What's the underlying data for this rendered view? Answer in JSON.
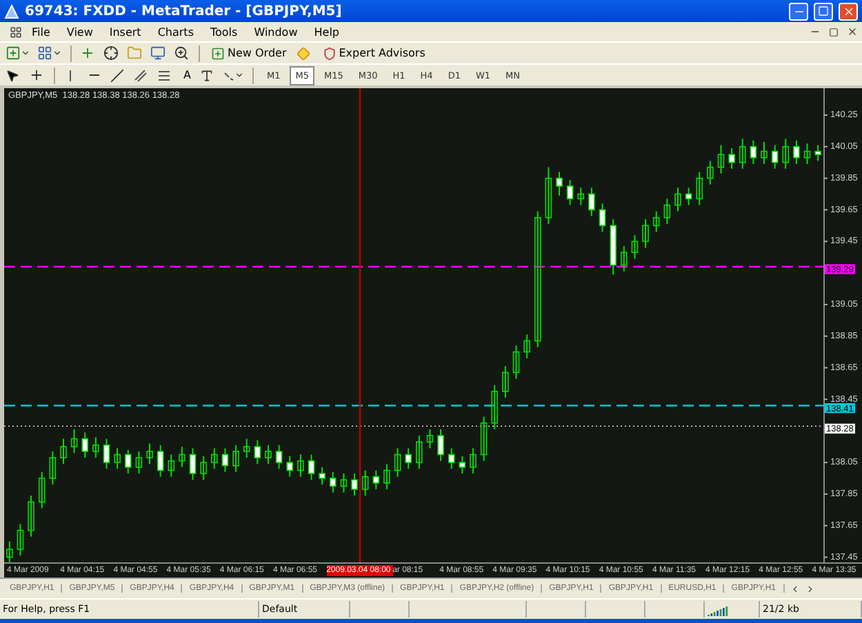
{
  "window": {
    "title": "69743: FXDD - MetaTrader - [GBPJPY,M5]"
  },
  "menu": [
    "File",
    "View",
    "Insert",
    "Charts",
    "Tools",
    "Window",
    "Help"
  ],
  "toolbar": {
    "new_order": "New Order",
    "expert_advisors": "Expert Advisors"
  },
  "drawing_tools": {
    "text_tool": "A"
  },
  "periods": [
    {
      "label": "M1",
      "selected": false
    },
    {
      "label": "M5",
      "selected": true
    },
    {
      "label": "M15",
      "selected": false
    },
    {
      "label": "M30",
      "selected": false
    },
    {
      "label": "H1",
      "selected": false
    },
    {
      "label": "H4",
      "selected": false
    },
    {
      "label": "D1",
      "selected": false
    },
    {
      "label": "W1",
      "selected": false
    },
    {
      "label": "MN",
      "selected": false
    }
  ],
  "chart": {
    "info": "GBPJPY,M5  138.28 138.38 138.26 138.28",
    "chart_data": {
      "type": "candlestick",
      "ylim": [
        137.4,
        140.42
      ],
      "ref_lines": [
        {
          "axis": "y",
          "value": 139.29,
          "label": "139.29",
          "color": "#ff00ff"
        },
        {
          "axis": "y",
          "value": 138.41,
          "label": "138.41",
          "color": "#00c8d8"
        },
        {
          "axis": "y",
          "value": 138.28,
          "label": "138.28",
          "color": "#ffffff"
        }
      ],
      "yticks": [
        140.25,
        140.05,
        139.85,
        139.65,
        139.45,
        139.05,
        138.85,
        138.65,
        138.45,
        138.05,
        137.85,
        137.65,
        137.45
      ],
      "ohlc": [
        [
          137.45,
          137.55,
          137.4,
          137.5
        ],
        [
          137.5,
          137.66,
          137.46,
          137.62
        ],
        [
          137.62,
          137.84,
          137.58,
          137.8
        ],
        [
          137.8,
          137.99,
          137.76,
          137.95
        ],
        [
          137.95,
          138.12,
          137.91,
          138.08
        ],
        [
          138.08,
          138.2,
          138.04,
          138.15
        ],
        [
          138.15,
          138.26,
          138.11,
          138.2
        ],
        [
          138.2,
          138.24,
          138.08,
          138.12
        ],
        [
          138.12,
          138.21,
          138.08,
          138.16
        ],
        [
          138.16,
          138.2,
          138.01,
          138.05
        ],
        [
          138.05,
          138.14,
          138.01,
          138.1
        ],
        [
          138.1,
          138.13,
          137.98,
          138.02
        ],
        [
          138.02,
          138.12,
          137.98,
          138.08
        ],
        [
          138.08,
          138.17,
          138.04,
          138.12
        ],
        [
          138.12,
          138.16,
          137.96,
          138.0
        ],
        [
          138.0,
          138.1,
          137.96,
          138.06
        ],
        [
          138.06,
          138.15,
          138.02,
          138.1
        ],
        [
          138.1,
          138.14,
          137.94,
          137.98
        ],
        [
          137.98,
          138.09,
          137.94,
          138.05
        ],
        [
          138.05,
          138.14,
          138.01,
          138.1
        ],
        [
          138.1,
          138.14,
          137.99,
          138.03
        ],
        [
          138.03,
          138.16,
          137.99,
          138.12
        ],
        [
          138.12,
          138.2,
          138.08,
          138.15
        ],
        [
          138.15,
          138.19,
          138.04,
          138.08
        ],
        [
          138.08,
          138.16,
          138.04,
          138.12
        ],
        [
          138.12,
          138.16,
          138.01,
          138.05
        ],
        [
          138.05,
          138.09,
          137.96,
          138.0
        ],
        [
          138.0,
          138.1,
          137.96,
          138.06
        ],
        [
          138.06,
          138.1,
          137.94,
          137.98
        ],
        [
          137.98,
          138.02,
          137.91,
          137.95
        ],
        [
          137.95,
          137.99,
          137.86,
          137.9
        ],
        [
          137.9,
          137.98,
          137.86,
          137.94
        ],
        [
          137.94,
          137.98,
          137.84,
          137.88
        ],
        [
          137.88,
          138.0,
          137.84,
          137.96
        ],
        [
          137.96,
          138.0,
          137.88,
          137.92
        ],
        [
          137.92,
          138.04,
          137.88,
          138.0
        ],
        [
          138.0,
          138.14,
          137.96,
          138.1
        ],
        [
          138.1,
          138.14,
          138.01,
          138.05
        ],
        [
          138.05,
          138.22,
          138.01,
          138.18
        ],
        [
          138.18,
          138.26,
          138.14,
          138.22
        ],
        [
          138.22,
          138.26,
          138.06,
          138.1
        ],
        [
          138.1,
          138.14,
          138.01,
          138.05
        ],
        [
          138.05,
          138.09,
          137.98,
          138.02
        ],
        [
          138.02,
          138.14,
          137.98,
          138.1
        ],
        [
          138.1,
          138.34,
          138.06,
          138.3
        ],
        [
          138.3,
          138.54,
          138.26,
          138.5
        ],
        [
          138.5,
          138.66,
          138.46,
          138.62
        ],
        [
          138.62,
          138.79,
          138.58,
          138.75
        ],
        [
          138.75,
          138.86,
          138.71,
          138.82
        ],
        [
          138.82,
          139.64,
          138.78,
          139.6
        ],
        [
          139.6,
          139.92,
          139.56,
          139.85
        ],
        [
          139.85,
          139.89,
          139.74,
          139.8
        ],
        [
          139.8,
          139.84,
          139.68,
          139.72
        ],
        [
          139.72,
          139.79,
          139.68,
          139.75
        ],
        [
          139.75,
          139.79,
          139.61,
          139.65
        ],
        [
          139.65,
          139.69,
          139.51,
          139.55
        ],
        [
          139.55,
          139.59,
          139.24,
          139.3
        ],
        [
          139.3,
          139.42,
          139.26,
          139.38
        ],
        [
          139.38,
          139.49,
          139.34,
          139.45
        ],
        [
          139.45,
          139.59,
          139.41,
          139.55
        ],
        [
          139.55,
          139.64,
          139.51,
          139.6
        ],
        [
          139.6,
          139.72,
          139.56,
          139.68
        ],
        [
          139.68,
          139.79,
          139.64,
          139.75
        ],
        [
          139.75,
          139.79,
          139.68,
          139.72
        ],
        [
          139.72,
          139.89,
          139.68,
          139.85
        ],
        [
          139.85,
          139.96,
          139.81,
          139.92
        ],
        [
          139.92,
          140.06,
          139.88,
          140.0
        ],
        [
          140.0,
          140.04,
          139.91,
          139.95
        ],
        [
          139.95,
          140.1,
          139.91,
          140.05
        ],
        [
          140.05,
          140.09,
          139.94,
          139.98
        ],
        [
          139.98,
          140.08,
          139.94,
          140.02
        ],
        [
          140.02,
          140.06,
          139.91,
          139.95
        ],
        [
          139.95,
          140.1,
          139.91,
          140.05
        ],
        [
          140.05,
          140.09,
          139.94,
          139.98
        ],
        [
          139.98,
          140.07,
          139.94,
          140.02
        ],
        [
          140.02,
          140.06,
          139.96,
          140.0
        ]
      ]
    },
    "time_labels": [
      {
        "label": "4 Mar 2009",
        "kind": "normal"
      },
      {
        "label": "4 Mar 04:15",
        "kind": "normal"
      },
      {
        "label": "4 Mar 04:55",
        "kind": "normal"
      },
      {
        "label": "4 Mar 05:35",
        "kind": "normal"
      },
      {
        "label": "4 Mar 06:15",
        "kind": "normal"
      },
      {
        "label": "4 Mar 06:55",
        "kind": "normal"
      },
      {
        "label": "2009.03.04 08:00",
        "kind": "cursor"
      },
      {
        "label": "ar 08:15",
        "kind": "cut"
      },
      {
        "label": "4 Mar 08:55",
        "kind": "normal"
      },
      {
        "label": "4 Mar 09:35",
        "kind": "normal"
      },
      {
        "label": "4 Mar 10:15",
        "kind": "normal"
      },
      {
        "label": "4 Mar 10:55",
        "kind": "normal"
      },
      {
        "label": "4 Mar 11:35",
        "kind": "normal"
      },
      {
        "label": "4 Mar 12:15",
        "kind": "normal"
      },
      {
        "label": "4 Mar 12:55",
        "kind": "normal"
      },
      {
        "label": "4 Mar 13:35",
        "kind": "normal"
      }
    ]
  },
  "chart_tabs": [
    "GBPJPY,H1",
    "GBPJPY,M5",
    "GBPJPY,H4",
    "GBPJPY,H4",
    "GBPJPY,M1",
    "GBPJPY,M3 (offline)",
    "GBPJPY,H1",
    "GBPJPY,H2 (offline)",
    "GBPJPY,H1",
    "GBPJPY,H1",
    "EURUSD,H1",
    "GBPJPY,H1"
  ],
  "status_bar": {
    "help": "For Help, press F1",
    "profile": "Default",
    "traffic": "21/2 kb"
  }
}
